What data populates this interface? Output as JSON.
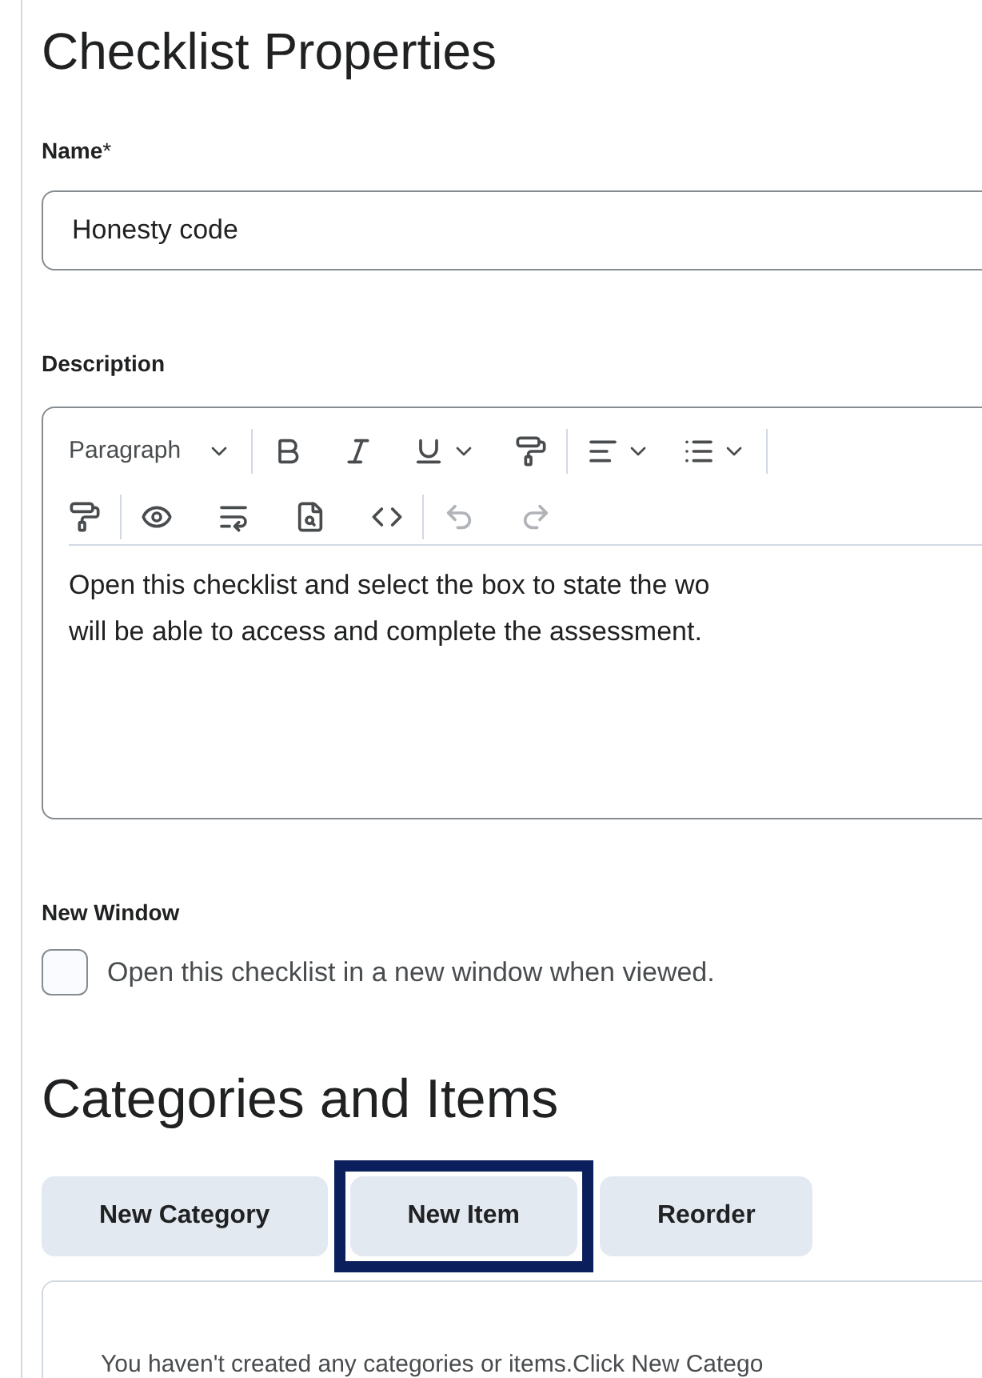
{
  "title": "Checklist Properties",
  "name_field": {
    "label": "Name",
    "required_mark": "*",
    "value": "Honesty code"
  },
  "description": {
    "label": "Description",
    "format": "Paragraph",
    "lines": [
      "Open this checklist and select the box to state the wo",
      "will be able to access and complete the assessment."
    ]
  },
  "new_window": {
    "label": "New Window",
    "option": "Open this checklist in a new window when viewed.",
    "checked": false
  },
  "section_title": "Categories and Items",
  "buttons": [
    {
      "label": "New Category",
      "highlighted": false
    },
    {
      "label": "New Item",
      "highlighted": true
    },
    {
      "label": "Reorder",
      "highlighted": false
    }
  ],
  "empty_message": "You haven't created any categories or items.Click New Catego"
}
